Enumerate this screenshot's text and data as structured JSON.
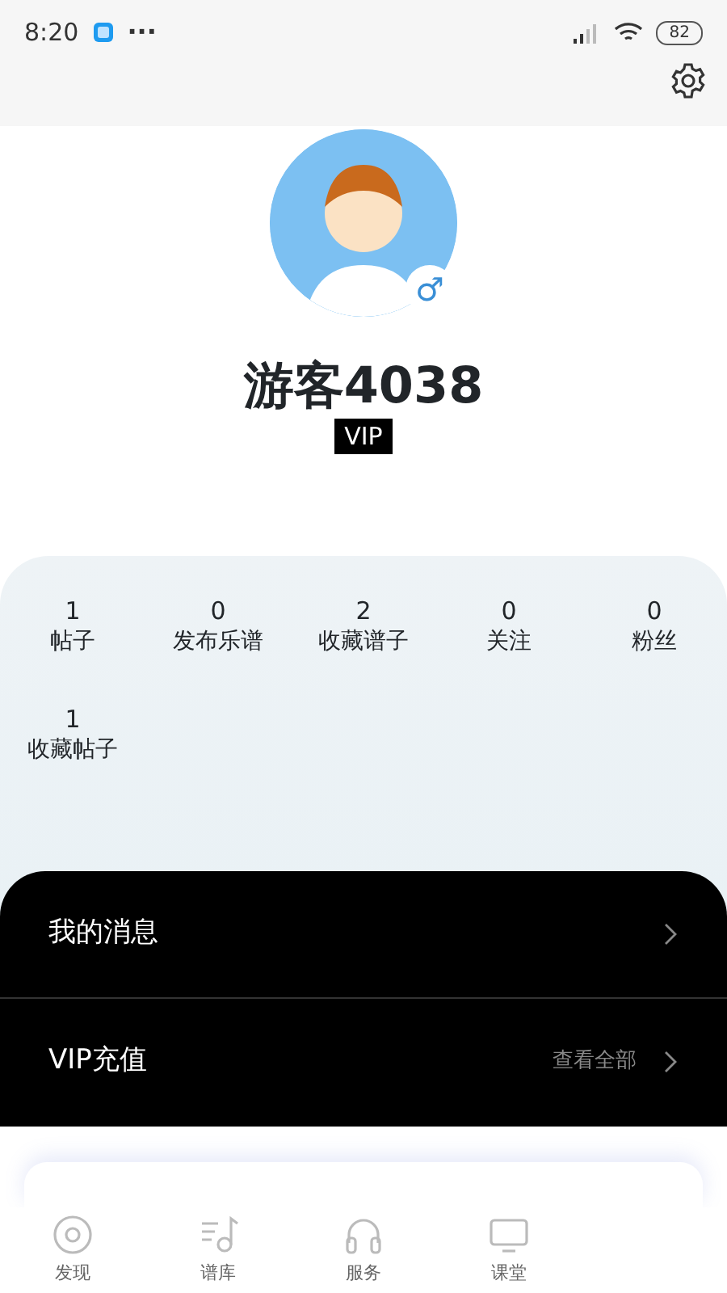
{
  "status_bar": {
    "time": "8:20",
    "more": "···",
    "battery": "82"
  },
  "profile": {
    "name": "游客4038",
    "badge": "VIP",
    "gender": "♂"
  },
  "stats": [
    {
      "value": "1",
      "label": "帖子"
    },
    {
      "value": "0",
      "label": "发布乐谱"
    },
    {
      "value": "2",
      "label": "收藏谱子"
    },
    {
      "value": "0",
      "label": "关注"
    },
    {
      "value": "0",
      "label": "粉丝"
    },
    {
      "value": "1",
      "label": "收藏帖子"
    }
  ],
  "menu": [
    {
      "label": "我的消息"
    },
    {
      "label": "VIP充值",
      "hint": "查看全部"
    }
  ],
  "tab_bar": [
    {
      "label": "发现",
      "kind": "disc"
    },
    {
      "label": "谱库",
      "kind": "note"
    },
    {
      "label": "服务",
      "kind": "headphones"
    },
    {
      "label": "课堂",
      "kind": "screen"
    }
  ]
}
